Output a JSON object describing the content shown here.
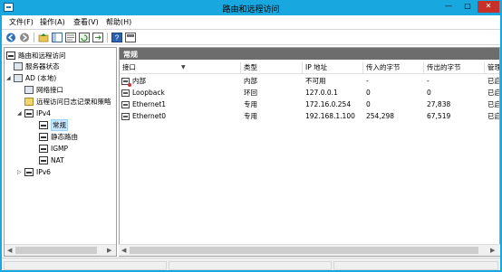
{
  "window": {
    "title": "路由和远程访问",
    "min_glyph": "—",
    "max_glyph": "□",
    "close_glyph": "✕"
  },
  "menu": [
    "文件(F)",
    "操作(A)",
    "查看(V)",
    "帮助(H)"
  ],
  "toolbar": {
    "buttons": [
      "back-icon",
      "forward-icon",
      "up-folder-icon",
      "show-hide-tree-icon",
      "properties-icon",
      "refresh-icon",
      "export-icon",
      "help-icon",
      "console-icon"
    ]
  },
  "tree": {
    "root": "路由和远程访问",
    "server_status": "服务器状态",
    "server": "AD (本地)",
    "network_interfaces": "网络接口",
    "remote_access_logging": "远程访问日志记录和策略",
    "ipv4": "IPv4",
    "general": "常规",
    "static_routes": "静态路由",
    "igmp": "IGMP",
    "nat": "NAT",
    "ipv6": "IPv6"
  },
  "content": {
    "title": "常规",
    "columns": [
      "接口",
      "类型",
      "IP 地址",
      "传入的字节",
      "传出的字节",
      "管理状态"
    ],
    "rows": [
      {
        "interface": "内部",
        "type": "内部",
        "ip": "不可用",
        "bytes_in": "-",
        "bytes_out": "-",
        "status": "已启用"
      },
      {
        "interface": "Loopback",
        "type": "环回",
        "ip": "127.0.0.1",
        "bytes_in": "0",
        "bytes_out": "0",
        "status": "已启用"
      },
      {
        "interface": "Ethernet1",
        "type": "专用",
        "ip": "172.16.0.254",
        "bytes_in": "0",
        "bytes_out": "27,838",
        "status": "已启用"
      },
      {
        "interface": "Ethernet0",
        "type": "专用",
        "ip": "192.168.1.100",
        "bytes_in": "254,298",
        "bytes_out": "67,519",
        "status": "已启用"
      }
    ]
  },
  "colors": {
    "titlebar": "#19a7e0",
    "header_bar": "#6d6d6d",
    "close_button": "#c7312a",
    "selection": "#cce8ff"
  }
}
